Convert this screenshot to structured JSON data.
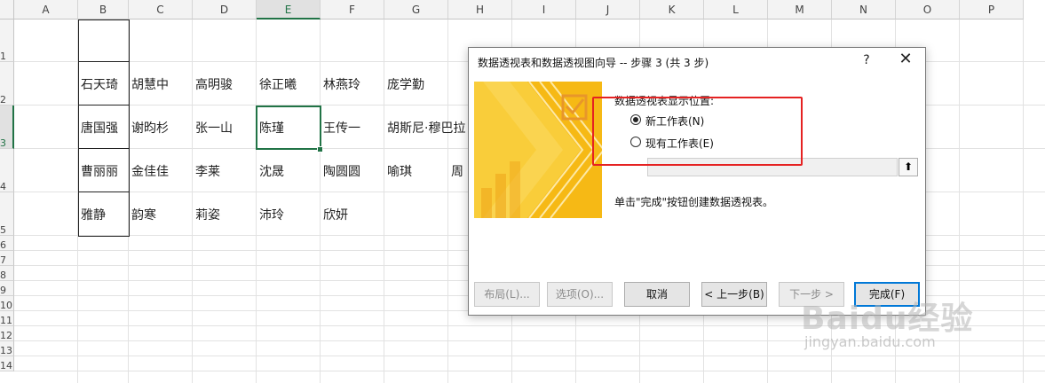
{
  "columns": [
    "A",
    "B",
    "C",
    "D",
    "E",
    "F",
    "G",
    "H",
    "I",
    "J",
    "K",
    "L",
    "M",
    "N",
    "O",
    "P"
  ],
  "rows": [
    "1",
    "2",
    "3",
    "4",
    "5",
    "6",
    "7",
    "8",
    "9",
    "10",
    "11",
    "12",
    "13",
    "14"
  ],
  "selected_column": "E",
  "selected_row": "3",
  "cells": {
    "r2": [
      "石天琦",
      "胡慧中",
      "高明骏",
      "徐正曦",
      "林燕玲",
      "庞学勤"
    ],
    "r3": [
      "唐国强",
      "谢昀杉",
      "张一山",
      "陈瑾",
      "王传一",
      "胡斯尼·穆巴拉"
    ],
    "r4": [
      "曹丽丽",
      "金佳佳",
      "李莱",
      "沈晟",
      "陶圆圆",
      "喻琪",
      "周"
    ],
    "r5": [
      "雅静",
      "韵寒",
      "莉姿",
      "沛玲",
      "欣妍"
    ]
  },
  "dialog": {
    "title": "数据透视表和数据透视图向导 -- 步骤 3 (共 3 步)",
    "help": "?",
    "close": "✕",
    "location_label": "数据透视表显示位置:",
    "options": [
      {
        "label": "新工作表(N)",
        "selected": true
      },
      {
        "label": "现有工作表(E)",
        "selected": false
      }
    ],
    "range_button": "⬆",
    "hint": "单击\"完成\"按钮创建数据透视表。",
    "buttons": {
      "layout": "布局(L)...",
      "options": "选项(O)...",
      "cancel": "取消",
      "back": "< 上一步(B)",
      "next": "下一步 >",
      "finish": "完成(F)"
    }
  },
  "highlight_color": "#e52222",
  "accent_color": "#217346",
  "watermark": {
    "brand": "Baidu经验",
    "url": "jingyan.baidu.com"
  }
}
